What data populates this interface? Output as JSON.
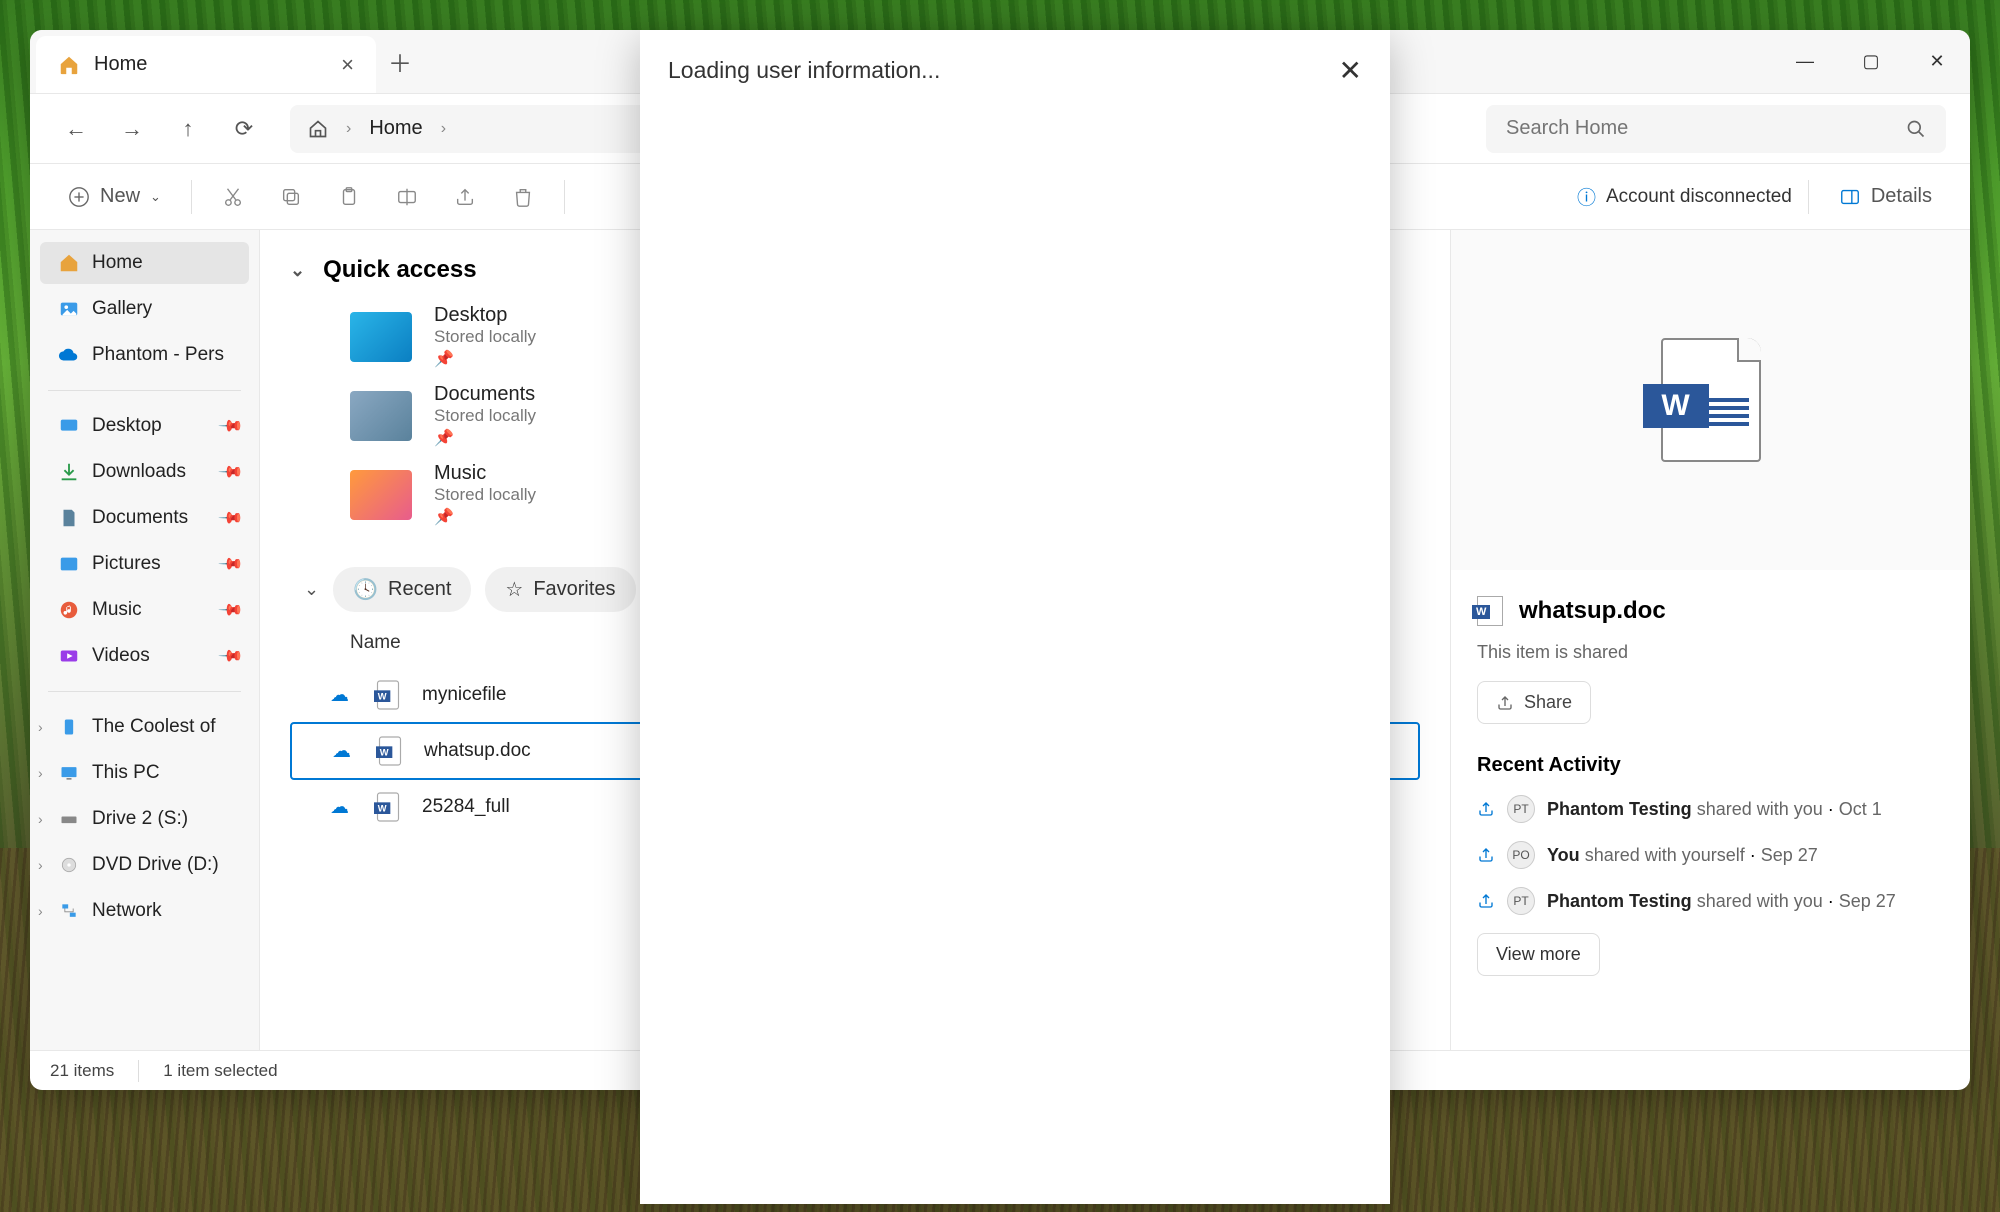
{
  "tab": {
    "title": "Home"
  },
  "breadcrumb": {
    "location": "Home"
  },
  "search": {
    "placeholder": "Search Home"
  },
  "toolbar": {
    "new_label": "New",
    "account_status": "Account disconnected",
    "details_label": "Details"
  },
  "sidebar": {
    "top": [
      {
        "label": "Home"
      },
      {
        "label": "Gallery"
      },
      {
        "label": "Phantom - Pers"
      }
    ],
    "pinned": [
      {
        "label": "Desktop"
      },
      {
        "label": "Downloads"
      },
      {
        "label": "Documents"
      },
      {
        "label": "Pictures"
      },
      {
        "label": "Music"
      },
      {
        "label": "Videos"
      }
    ],
    "drives": [
      {
        "label": "The Coolest of"
      },
      {
        "label": "This PC"
      },
      {
        "label": "Drive 2 (S:)"
      },
      {
        "label": "DVD Drive (D:)"
      },
      {
        "label": "Network"
      }
    ]
  },
  "quick_access": {
    "title": "Quick access",
    "items": [
      {
        "name": "Desktop",
        "sub": "Stored locally"
      },
      {
        "name": "Documents",
        "sub": "Stored locally"
      },
      {
        "name": "Music",
        "sub": "Stored locally"
      }
    ]
  },
  "filters": {
    "recent": "Recent",
    "favorites": "Favorites"
  },
  "columns": {
    "name": "Name"
  },
  "files": [
    {
      "name": "mynicefile"
    },
    {
      "name": "whatsup.doc"
    },
    {
      "name": "25284_full"
    }
  ],
  "details": {
    "filename": "whatsup.doc",
    "shared_text": "This item is shared",
    "share_label": "Share",
    "activity_title": "Recent Activity",
    "activities": [
      {
        "initials": "PT",
        "who": "Phantom Testing",
        "what": "shared with you",
        "date": "Oct 1"
      },
      {
        "initials": "PO",
        "who": "You",
        "what": "shared with yourself",
        "date": "Sep 27"
      },
      {
        "initials": "PT",
        "who": "Phantom Testing",
        "what": "shared with you",
        "date": "Sep 27"
      }
    ],
    "view_more": "View more"
  },
  "statusbar": {
    "count": "21 items",
    "selection": "1 item selected"
  },
  "modal": {
    "title": "Loading user information..."
  }
}
